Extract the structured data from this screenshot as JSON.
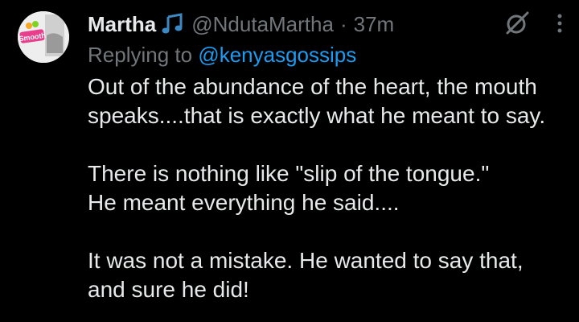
{
  "tweet": {
    "display_name": "Martha",
    "name_emoji": "music-notes-icon",
    "handle": "@NdutaMartha",
    "separator": "·",
    "time": "37m",
    "replying_prefix": "Replying to",
    "replying_handle": "@kenyasgossips",
    "avatar_logo_text": "Smooth",
    "paragraphs": [
      {
        "lines": [
          "Out of the abundance of the heart, the mouth",
          "speaks....that is exactly what he meant to say."
        ]
      },
      {
        "lines": [
          "There is nothing like \"slip of the tongue.\"",
          "He meant everything he said...."
        ]
      },
      {
        "lines": [
          "It was not a mistake. He wanted to say that,",
          "and sure he did!"
        ]
      }
    ]
  },
  "colors": {
    "background": "#000000",
    "text_primary": "#e7e9ea",
    "text_secondary": "#71767b",
    "link": "#1d9bf0",
    "music_emoji": "#3b88c3"
  }
}
